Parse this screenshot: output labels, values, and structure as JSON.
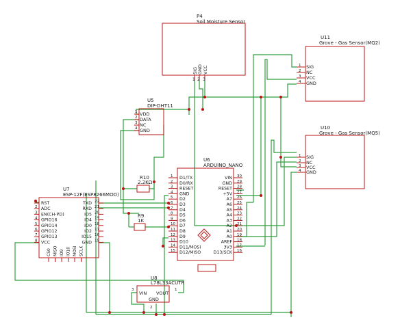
{
  "colors": {
    "wire": "#2f9e3c",
    "part": "#b81414",
    "junction": "#b81414",
    "text": "#1a1a1a"
  },
  "p4": {
    "ref": "P4",
    "value": "Soil Moisture Sensor",
    "pins": [
      "SIG",
      "GND",
      "VCC"
    ],
    "pin_nums": [
      "1",
      "2",
      "3"
    ]
  },
  "u11": {
    "ref": "U11",
    "value": "Grove - Gas Sensor(MQ2)",
    "pins": [
      "SIG",
      "NC",
      "VCC",
      "GND"
    ],
    "pin_nums": [
      "1",
      "2",
      "3",
      "4"
    ]
  },
  "u10": {
    "ref": "U10",
    "value": "Grove - Gas Sensor(MQ5)",
    "pins": [
      "SIG",
      "NC",
      "VCC",
      "GND"
    ],
    "pin_nums": [
      "1",
      "2",
      "3",
      "4"
    ]
  },
  "u5": {
    "ref": "U5",
    "value": "DIP-DHT11",
    "pins": [
      "VDD",
      "DATA",
      "NC",
      "GND"
    ],
    "pin_nums": [
      "1",
      "2",
      "3",
      "4"
    ]
  },
  "u6": {
    "ref": "U6",
    "value": "ARDUINO_NANO",
    "left_pins": [
      "D1/TX",
      "D0/RX",
      "RESET",
      "GND",
      "D2",
      "D3",
      "D4",
      "D5",
      "D6",
      "D7",
      "D8",
      "D9",
      "D10",
      "D11/MOSI",
      "D12/MISO"
    ],
    "left_nums": [
      "1",
      "2",
      "3",
      "4",
      "5",
      "6",
      "7",
      "8",
      "9",
      "10",
      "11",
      "12",
      "13",
      "14",
      "15"
    ],
    "right_pins": [
      "VIN",
      "GND",
      "RESET",
      "+5V",
      "A7",
      "A6",
      "A5",
      "A4",
      "A3",
      "A2",
      "A1",
      "A0",
      "AREF",
      "3V3",
      "D13/SCK"
    ],
    "right_nums": [
      "30",
      "29",
      "28",
      "27",
      "26",
      "25",
      "24",
      "23",
      "22",
      "21",
      "20",
      "19",
      "18",
      "17",
      "16"
    ]
  },
  "u7": {
    "ref": "U7",
    "value": "ESP-12F(ESP8266MOD)",
    "left_pins": [
      "RST",
      "ADC",
      "EN(CH-PD)",
      "GPIO16",
      "GPIO14",
      "GPIO12",
      "GPIO13",
      "VCC"
    ],
    "left_nums": [
      "1",
      "2",
      "3",
      "4",
      "5",
      "6",
      "7",
      "8"
    ],
    "right_pins": [
      "TXD",
      "RXD",
      "IO5",
      "IO4",
      "IO0",
      "IO2",
      "IO15",
      "GND"
    ],
    "right_nums": [
      "22",
      "21",
      "20",
      "19",
      "18",
      "17",
      "16",
      "15"
    ],
    "bottom_pins": [
      "CS0",
      "MISO",
      "IO9",
      "IO10",
      "MOSI",
      "SCLK"
    ]
  },
  "u8": {
    "ref": "U8",
    "value": "L78L33ACUTR",
    "pins": [
      "VIN",
      "VOUT",
      "GND"
    ],
    "pin_nums": [
      "3",
      "1",
      "2"
    ]
  },
  "r10": {
    "ref": "R10",
    "value": "2.2KΩ"
  },
  "r9": {
    "ref": "R9",
    "value": "1K"
  }
}
